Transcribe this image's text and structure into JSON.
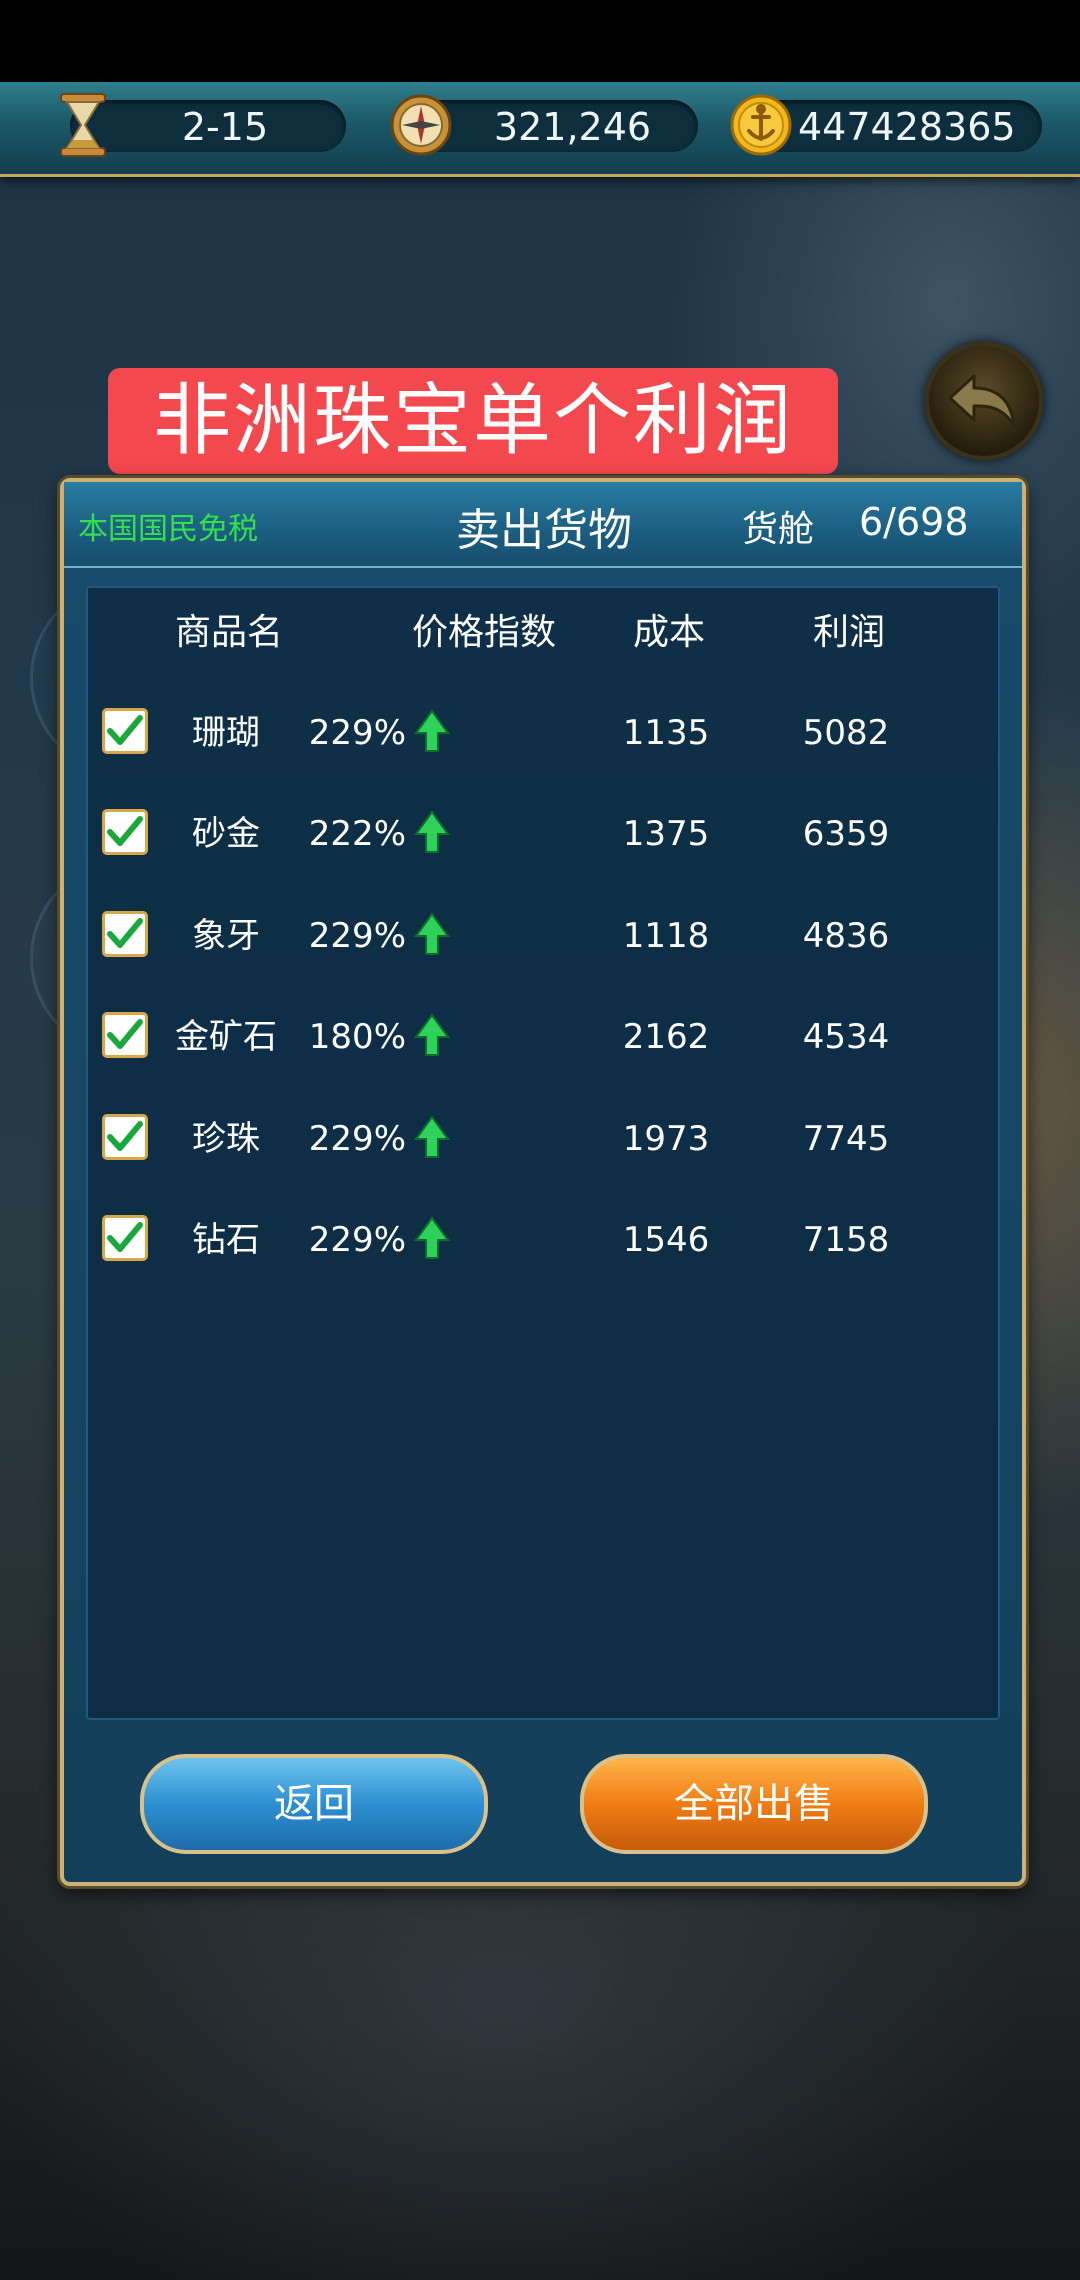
{
  "hud": {
    "level": "2-15",
    "compass_value": "321,246",
    "gold_value": "447428365",
    "icons": [
      "hourglass-icon",
      "compass-icon",
      "gold-anchor-coin-icon"
    ]
  },
  "banner": {
    "text": "非洲珠宝单个利润"
  },
  "panel": {
    "tax_note": "本国国民免税",
    "title": "卖出货物",
    "hold_label": "货舱",
    "hold_value": "6/698"
  },
  "table": {
    "headers": [
      "商品名",
      "价格指数",
      "成本",
      "利润"
    ],
    "rows": [
      {
        "name": "珊瑚",
        "index": "229%",
        "cost": "1135",
        "profit": "5082",
        "checked": true,
        "trend": "up"
      },
      {
        "name": "砂金",
        "index": "222%",
        "cost": "1375",
        "profit": "6359",
        "checked": true,
        "trend": "up"
      },
      {
        "name": "象牙",
        "index": "229%",
        "cost": "1118",
        "profit": "4836",
        "checked": true,
        "trend": "up"
      },
      {
        "name": "金矿石",
        "index": "180%",
        "cost": "2162",
        "profit": "4534",
        "checked": true,
        "trend": "up"
      },
      {
        "name": "珍珠",
        "index": "229%",
        "cost": "1973",
        "profit": "7745",
        "checked": true,
        "trend": "up"
      },
      {
        "name": "钻石",
        "index": "229%",
        "cost": "1546",
        "profit": "7158",
        "checked": true,
        "trend": "up"
      }
    ]
  },
  "buttons": {
    "back": "返回",
    "sell_all": "全部出售"
  },
  "colors": {
    "tax_note": "#35e04b",
    "banner_bg": "#f2484e",
    "trend_up": "#2fd15a",
    "check": "#1aa83c",
    "panel_border": "#cbb177"
  }
}
